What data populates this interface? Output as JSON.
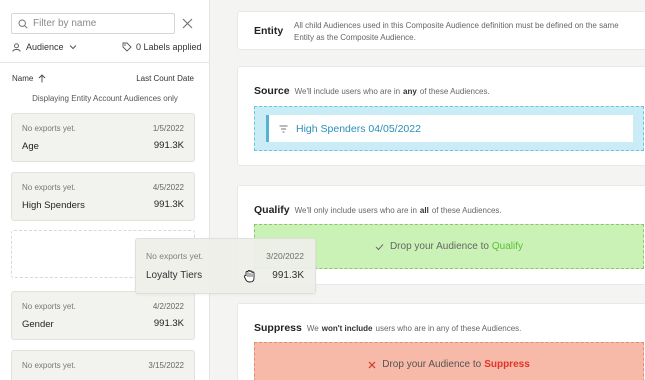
{
  "sidebar": {
    "filter": {
      "placeholder": "Filter by name"
    },
    "audience_type": "Audience",
    "labels_applied": "0 Labels applied",
    "columns": {
      "name": "Name",
      "last_count_date": "Last Count Date"
    },
    "scope_note": "Displaying Entity Account Audiences only",
    "cards": [
      {
        "exports": "No exports yet.",
        "date": "1/5/2022",
        "name": "Age",
        "count": "991.3K"
      },
      {
        "exports": "No exports yet.",
        "date": "4/5/2022",
        "name": "High Spenders",
        "count": "991.3K"
      },
      {
        "exports": "No exports yet.",
        "date": "4/2/2022",
        "name": "Gender",
        "count": "991.3K"
      },
      {
        "exports": "No exports yet.",
        "date": "3/15/2022",
        "name": "",
        "count": ""
      }
    ],
    "dragging": {
      "exports": "No exports yet.",
      "date": "3/20/2022",
      "name": "Loyalty Tiers",
      "count": "991.3K"
    }
  },
  "entity": {
    "title": "Entity",
    "note": "All child Audiences used in this Composite Audience definition must be defined on the same Entity as the Composite Audience."
  },
  "source": {
    "title": "Source",
    "pre": "We'll include users who are in",
    "emph": "any",
    "post": "of these Audiences.",
    "chip": "High Spenders 04/05/2022"
  },
  "qualify": {
    "title": "Qualify",
    "pre": "We'll only include users who are in",
    "emph": "all",
    "post": "of these Audiences.",
    "drop_prefix": "Drop your Audience to",
    "drop_target": "Qualify"
  },
  "suppress": {
    "title": "Suppress",
    "pre": "We",
    "emph": "won't include",
    "post": "users who are in any of these Audiences.",
    "drop_prefix": "Drop your Audience to",
    "drop_target": "Suppress"
  },
  "colors": {
    "source": "#c9ecf6",
    "qualify": "#caf2b6",
    "suppress": "#f7b9a8"
  }
}
